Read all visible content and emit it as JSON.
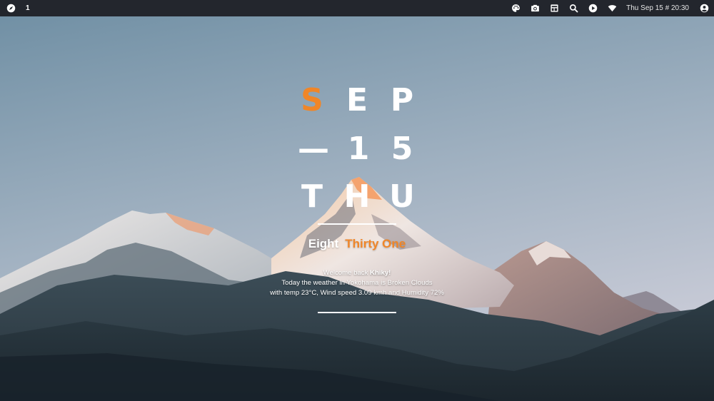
{
  "topbar": {
    "launcher_icon": "compass-icon",
    "workspace": "1",
    "tray_icons": [
      "palette-icon",
      "camera-icon",
      "sidebar-panel-icon",
      "search-icon",
      "play-icon",
      "wifi-icon"
    ],
    "clock": "Thu Sep 15 # 20:30",
    "user_icon": "user-account-icon"
  },
  "widget": {
    "month": [
      "S",
      "E",
      "P"
    ],
    "day": [
      "—",
      "1",
      "5"
    ],
    "weekday": [
      "T",
      "H",
      "U"
    ],
    "time_hour": "Eight",
    "time_minutes": "Thirty One",
    "welcome_prefix": "Welcome back ",
    "username": "Khiky!",
    "weather_line": "Today the weather in Yokohama is Broken Clouds",
    "stats_line": "with temp 23°C, Wind speed 3.09 kmh and Humidity 72%"
  },
  "colors": {
    "accent": "#f08628",
    "topbar_bg": "#23262d",
    "text": "#ffffff"
  }
}
